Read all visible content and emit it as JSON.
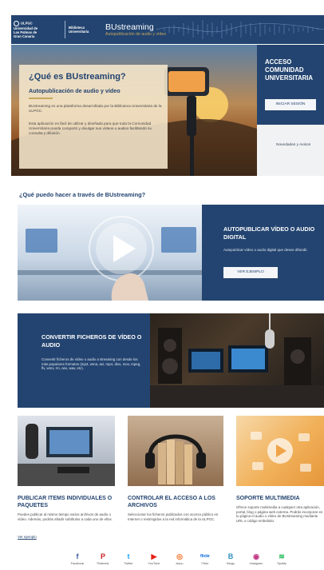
{
  "header": {
    "university_lines": [
      "ULPGC",
      "Universidad de",
      "Las Palmas de",
      "Gran Canaria"
    ],
    "library_lines": [
      "Biblioteca",
      "Universitaria"
    ],
    "brand_name": "BUstreaming",
    "brand_tagline": "Autopublicación de audio y vídeo"
  },
  "hero": {
    "title": "¿Qué es BUstreaming?",
    "subtitle": "Autopublicación de audio y vídeo",
    "paragraph1": "BUstreaming es una plataforma desarrollada por la Biblioteca Universitaria de la ULPGC.",
    "paragraph2": "Esta aplicación es fácil de utilizar y diseñada para que toda la Comunidad Universitaria pueda compartir y divulgar sus vídeos o audios facilitando su consulta y difusión."
  },
  "access": {
    "title": "ACCESO COMUNIDAD UNIVERSITARIA",
    "login_button": "INICIAR SESIÓN",
    "news_link": "Novedades y Avisos"
  },
  "what_can_i_do": "¿Qué puedo hacer a través de BUstreaming?",
  "feature_publish": {
    "title": "AUTOPUBLICAR VÍDEO O AUDIO DIGITAL",
    "description": "Autopublicar vídeo o audio digital que desee difundir.",
    "button": "VER EJEMPLO"
  },
  "feature_convert": {
    "title": "CONVERTIR FICHEROS DE VÍDEO O AUDIO",
    "description": "Convertir ficheros de vídeo o audio a streaming con desde los más populares formatos (mp3, wma, avi, mp4, divx, mov, mpeg, flv, wmv, rm, asx, wav, etc)."
  },
  "columns": [
    {
      "title": "PUBLICAR ITEMS INDIVIDUALES O PAQUETES",
      "description": "Puedes publicar al mismo tiempo varios archivos de audio o vídeo. Además, podrás añadir subtítulos a cada uno de ellos.",
      "link": "Ver ejemplo"
    },
    {
      "title": "CONTROLAR EL ACCESO A LOS ARCHIVOS",
      "description": "Seleccionar los ficheros publicados con acceso público en Internet o restringidos a la red informática de la ULPGC."
    },
    {
      "title": "SOPORTE MULTIMEDIA",
      "description": "Ofrece soporte multimedia a cualquier otra aplicación, portal, blog o página web externa. Podrás incorporar en tu página el audio o vídeo de BUstreaming mediante URL o código embebido."
    }
  ],
  "social": [
    {
      "label": "Facebook",
      "icon": "facebook-icon",
      "color": "#3b5998",
      "glyph": "f"
    },
    {
      "label": "Pinterest",
      "icon": "pinterest-icon",
      "color": "#cb2027",
      "glyph": "P"
    },
    {
      "label": "Twitter",
      "icon": "twitter-icon",
      "color": "#1da1f2",
      "glyph": "t"
    },
    {
      "label": "YouTube",
      "icon": "youtube-icon",
      "color": "#e62117",
      "glyph": "▶"
    },
    {
      "label": "Issuu",
      "icon": "issuu-icon",
      "color": "#f36d21",
      "glyph": "◎"
    },
    {
      "label": "Flickr",
      "icon": "flickr-icon",
      "color": "#0063dc",
      "glyph": "flickr"
    },
    {
      "label": "Blogs",
      "icon": "blogs-icon",
      "color": "#2f8fbf",
      "glyph": "B"
    },
    {
      "label": "Instagram",
      "icon": "instagram-icon",
      "color": "#c13584",
      "glyph": "◉"
    },
    {
      "label": "Spotify",
      "icon": "spotify-icon",
      "color": "#1db954",
      "glyph": "≋"
    }
  ]
}
